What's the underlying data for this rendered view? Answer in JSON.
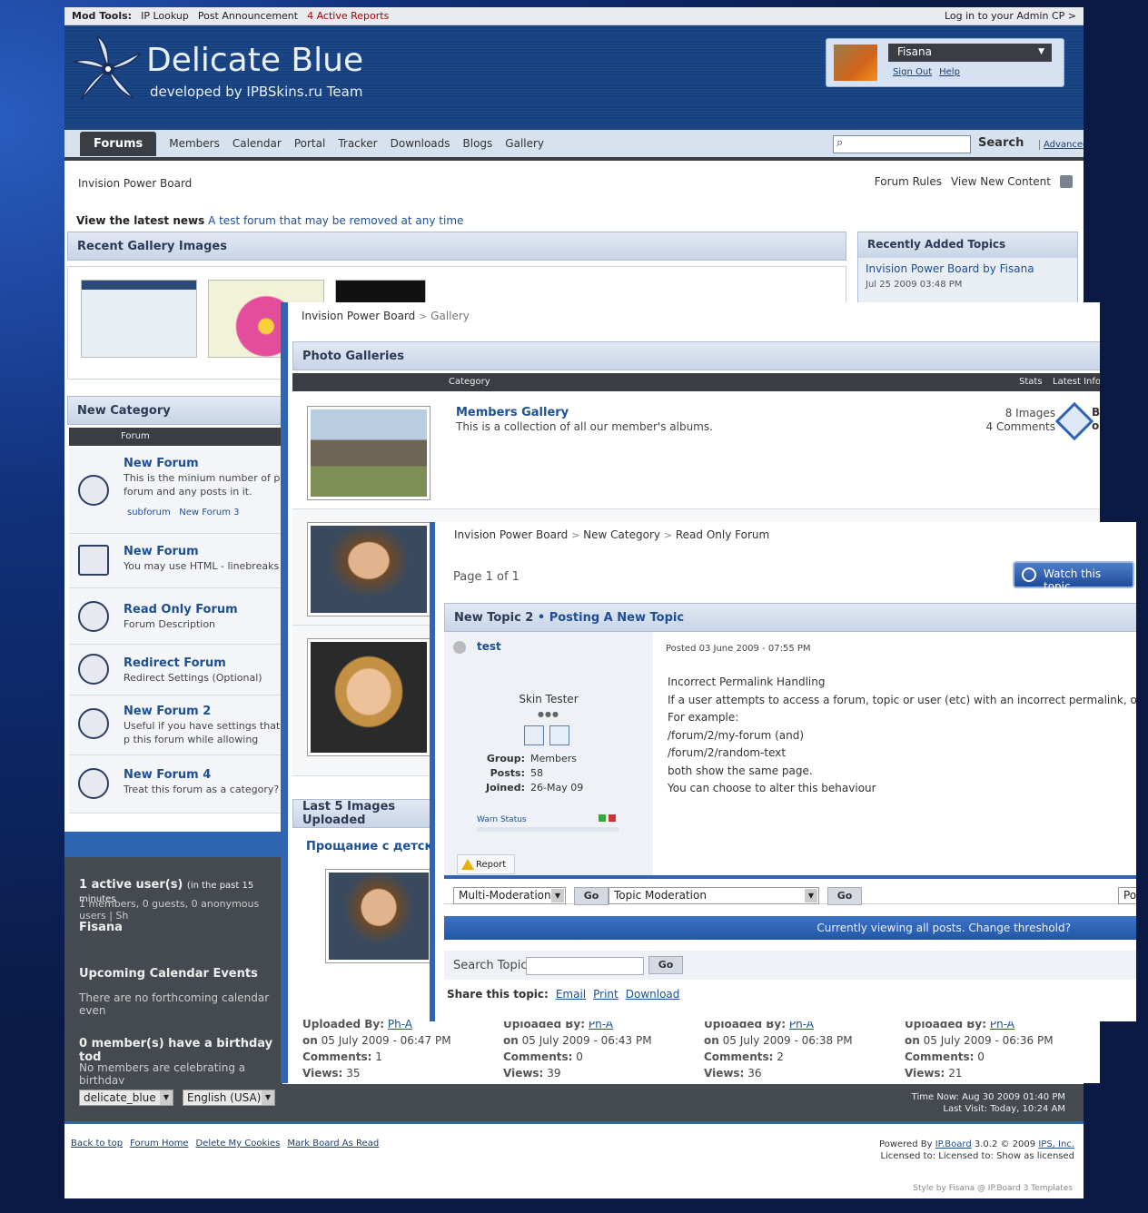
{
  "modtools": {
    "label": "Mod Tools:",
    "ip": "IP Lookup",
    "announce": "Post Announcement",
    "reports": "4 Active Reports",
    "admin": "Log in to your Admin CP >"
  },
  "logo": {
    "title": "Delicate Blue",
    "sub": "developed by IPBSkins.ru Team"
  },
  "user": {
    "name": "Fisana",
    "signout": "Sign Out",
    "help": "Help"
  },
  "nav": {
    "active": "Forums",
    "items": [
      "Members",
      "Calendar",
      "Portal",
      "Tracker",
      "Downloads",
      "Blogs",
      "Gallery"
    ],
    "search": "Search",
    "advanced": "Advanced"
  },
  "board": {
    "crumb": "Invision Power Board",
    "rules": "Forum Rules",
    "newcontent": "View New Content",
    "news_label": "View the latest news",
    "news_text": "A test forum that may be removed at any time"
  },
  "gallery_recent": {
    "title": "Recent Gallery Images"
  },
  "recent_topics": {
    "title": "Recently Added Topics",
    "topic": "Invision Power Board by Fisana",
    "date": "Jul 25 2009 03:48 PM"
  },
  "category": {
    "title": "New Category",
    "col": "Forum"
  },
  "forums": [
    {
      "title": "New Forum",
      "desc": "This is the minium number of p forum and any posts in it.",
      "sub1": "subforum",
      "sub2": "New Forum 3"
    },
    {
      "title": "New Forum",
      "desc": "You may use HTML - linebreaks"
    },
    {
      "title": "Read Only Forum",
      "desc": "Forum Description"
    },
    {
      "title": "Redirect Forum",
      "desc": "Redirect Settings (Optional)"
    },
    {
      "title": "New Forum 2",
      "desc": "Useful if you have settings that p this forum while allowing them t"
    },
    {
      "title": "New Forum 4",
      "desc": "Treat this forum as a category?"
    }
  ],
  "stats": {
    "active": "1 active user(s)",
    "active_sub": "(in the past 15 minutes",
    "counts": "1 members, 0 guests, 0 anonymous users | Sh",
    "member": "Fisana",
    "cal_title": "Upcoming Calendar Events",
    "cal_text": "There are no forthcoming calendar even",
    "bday_title": "0 member(s) have a birthday tod",
    "bday_text": "No members are celebrating a birthday"
  },
  "bottom": {
    "skin": "delicate_blue",
    "lang": "English (USA)",
    "time": "Time Now: Aug 30 2009 01:40 PM",
    "visit": "Last Visit: Today, 10:24 AM"
  },
  "footer": {
    "links": [
      "Back to top",
      "Forum Home",
      "Delete My Cookies",
      "Mark Board As Read"
    ],
    "powered": "Powered By",
    "ipboard": "IP.Board",
    "ver": "3.0.2 © 2009",
    "ips": "IPS, Inc.",
    "licensed": "Licensed to: Licensed to: Show as licensed",
    "styleby": "Style by Fisana @ IP.Board 3 Templates"
  },
  "gwin": {
    "crumb1": "Invision Power Board",
    "crumb2": "Gallery",
    "title": "Photo Galleries",
    "col_cat": "Category",
    "col_stats": "Stats",
    "col_latest": "Latest Info",
    "gal_title": "Members Gallery",
    "gal_desc": "This is a collection of all our member's albums.",
    "images": "8 Images",
    "comments": "4 Comments",
    "by": "By",
    "on": "on",
    "last5": "Last 5 Images Uploaded",
    "img_title": "Прощание с детским"
  },
  "uploads": [
    {
      "by_label": "Uploaded By:",
      "by": "Ph-A",
      "on": "on",
      "date": "05 July 2009 - 06:47 PM",
      "comments_label": "Comments:",
      "comments": "1",
      "views_label": "Views:",
      "views": "35"
    },
    {
      "by_label": "Uploaded By:",
      "by": "Ph-A",
      "on": "on",
      "date": "05 July 2009 - 06:43 PM",
      "comments_label": "Comments:",
      "comments": "0",
      "views_label": "Views:",
      "views": "39"
    },
    {
      "by_label": "Uploaded By:",
      "by": "Ph-A",
      "on": "on",
      "date": "05 July 2009 - 06:38 PM",
      "comments_label": "Comments:",
      "comments": "2",
      "views_label": "Views:",
      "views": "36"
    },
    {
      "by_label": "Uploaded By:",
      "by": "Ph-A",
      "on": "on",
      "date": "05 July 2009 - 06:36 PM",
      "comments_label": "Comments:",
      "comments": "0",
      "views_label": "Views:",
      "views": "21"
    }
  ],
  "twin": {
    "crumb1": "Invision Power Board",
    "crumb2": "New Category",
    "crumb3": "Read Only Forum",
    "page": "Page 1 of 1",
    "watch": "Watch this topic",
    "topic": "New Topic 2",
    "dot": "•",
    "posting": "Posting A New Topic",
    "poster": "test",
    "ptitle": "Skin Tester",
    "group_l": "Group:",
    "group": "Members",
    "posts_l": "Posts:",
    "posts": "58",
    "joined_l": "Joined:",
    "joined": "26-May 09",
    "warn": "Warn Status",
    "report": "Report",
    "posted": "Posted 03 June 2009 - 07:55 PM",
    "lines": [
      "Incorrect Permalink Handling",
      "If a user attempts to access a forum, topic or user (etc) with an incorrect permalink, ordina",
      "For example:",
      "/forum/2/my-forum (and)",
      "/forum/2/random-text",
      "both show the same page.",
      "You can choose to alter this behaviour"
    ],
    "multimod": "Multi-Moderation",
    "topicmod": "Topic Moderation",
    "go": "Go",
    "po": "Po",
    "threshold": "Currently viewing all posts. Change threshold?",
    "searchtopic": "Search Topic",
    "share": "Share this topic:",
    "email": "Email",
    "print": "Print",
    "download": "Download"
  }
}
